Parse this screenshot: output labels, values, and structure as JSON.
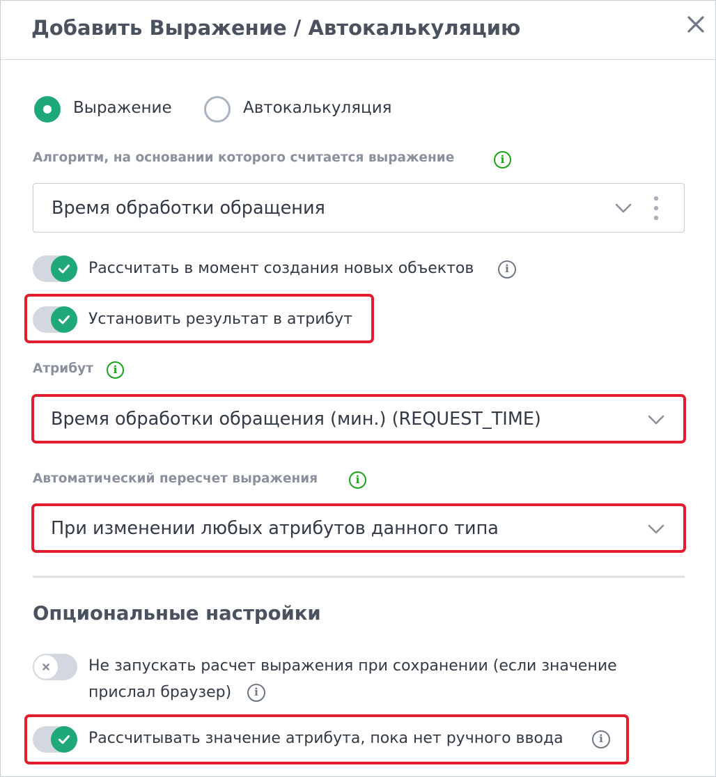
{
  "dialog": {
    "title": "Добавить Выражение / Автокалькуляцию",
    "close_icon": "close-icon"
  },
  "mode": {
    "options": [
      {
        "label": "Выражение",
        "selected": true
      },
      {
        "label": "Автокалькуляция",
        "selected": false
      }
    ]
  },
  "algorithm": {
    "label": "Алгоритм, на основании которого считается выражение",
    "value": "Время обработки обращения"
  },
  "toggles": {
    "calc_on_create": {
      "label": "Рассчитать в момент создания новых объектов",
      "on": true
    },
    "set_result": {
      "label": "Установить результат в атрибут",
      "on": true
    }
  },
  "attribute": {
    "label": "Атрибут",
    "value": "Время обработки обращения (мин.) (REQUEST_TIME)"
  },
  "recalc": {
    "label": "Автоматический пересчет выражения",
    "value": "При изменении любых атрибутов данного типа"
  },
  "optional": {
    "title": "Опциональные настройки",
    "skip_on_save": {
      "label_line1": "Не запускать расчет выражения при сохранении (если значение",
      "label_line2": "прислал браузер)",
      "on": false
    },
    "calc_until_manual": {
      "label": "Рассчитывать значение атрибута, пока нет ручного ввода",
      "on": true
    }
  },
  "colors": {
    "accent": "#1fa87a",
    "highlight": "#e11d2f",
    "info_green": "#1aa31a"
  }
}
